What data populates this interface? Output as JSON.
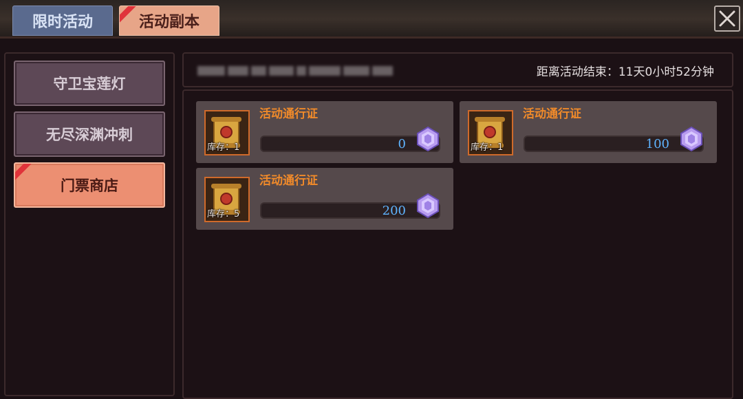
{
  "tabs": [
    {
      "label": "限时活动",
      "active": false
    },
    {
      "label": "活动副本",
      "active": true
    }
  ],
  "menu": [
    {
      "label": "守卫宝莲灯",
      "active": false
    },
    {
      "label": "无尽深渊冲刺",
      "active": false
    },
    {
      "label": "门票商店",
      "active": true
    }
  ],
  "header": {
    "countdown": "距离活动结束：11天0小时52分钟"
  },
  "items": [
    {
      "name": "活动通行证",
      "stock": "库存：1",
      "price": "0",
      "icon": "scroll-icon",
      "currency_icon": "crystal-icon"
    },
    {
      "name": "活动通行证",
      "stock": "库存：1",
      "price": "100",
      "icon": "scroll-icon",
      "currency_icon": "crystal-icon"
    },
    {
      "name": "活动通行证",
      "stock": "库存：5",
      "price": "200",
      "icon": "scroll-icon",
      "currency_icon": "crystal-icon"
    }
  ],
  "colors": {
    "accent": "#ec8f72",
    "price": "#5fb4ff",
    "item_name": "#f08a2a",
    "ribbon": "#e0333a"
  }
}
